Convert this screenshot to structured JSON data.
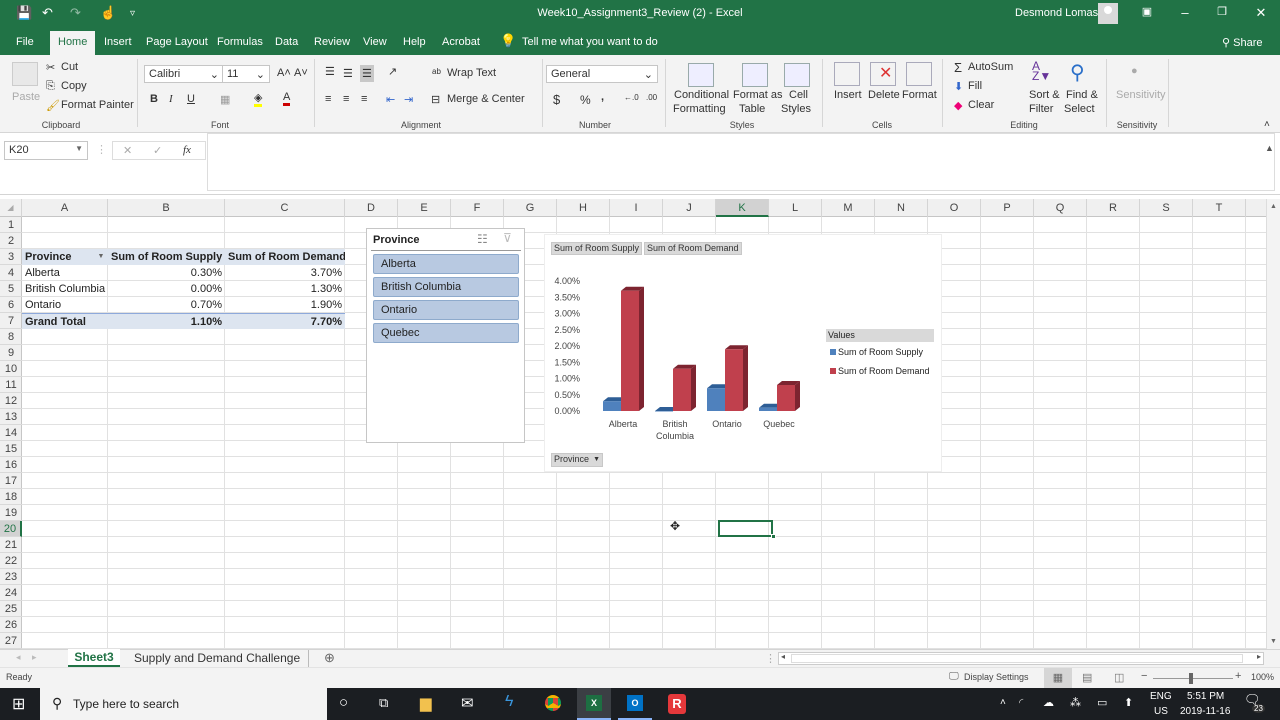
{
  "titlebar": {
    "title": "Week10_Assignment3_Review (2)  -  Excel",
    "user": "Desmond Lomas",
    "qat": {
      "save": "💾",
      "undo": "↶",
      "redo": "↷",
      "touch": "☝",
      "customize": "▿"
    }
  },
  "tabs": [
    "File",
    "Home",
    "Insert",
    "Page Layout",
    "Formulas",
    "Data",
    "Review",
    "View",
    "Help",
    "Acrobat"
  ],
  "tell_me": "Tell me what you want to do",
  "share": "Share",
  "ribbon": {
    "clipboard": {
      "paste": "Paste",
      "cut": "Cut",
      "copy": "Copy",
      "format_painter": "Format Painter",
      "label": "Clipboard"
    },
    "font": {
      "name": "Calibri",
      "size": "11",
      "label": "Font",
      "bold": "B",
      "italic": "I",
      "underline": "U"
    },
    "alignment": {
      "wrap": "Wrap Text",
      "merge": "Merge & Center",
      "label": "Alignment"
    },
    "number": {
      "format": "General",
      "label": "Number",
      "currency": "$",
      "percent": "%",
      "comma": ","
    },
    "styles": {
      "conditional": "Conditional",
      "conditional2": "Formatting",
      "format_table": "Format as",
      "format_table2": "Table",
      "cell_styles": "Cell",
      "cell_styles2": "Styles",
      "label": "Styles"
    },
    "cells": {
      "insert": "Insert",
      "delete": "Delete",
      "format": "Format",
      "label": "Cells"
    },
    "editing": {
      "autosum": "AutoSum",
      "fill": "Fill",
      "clear": "Clear",
      "sort": "Sort &",
      "sort2": "Filter",
      "find": "Find &",
      "find2": "Select",
      "label": "Editing"
    },
    "sensitivity": {
      "button": "Sensitivity",
      "label": "Sensitivity"
    }
  },
  "formula_bar": {
    "name_box": "K20",
    "cancel": "✕",
    "enter": "✓",
    "fx": "fx",
    "value": ""
  },
  "columns": [
    "A",
    "B",
    "C",
    "D",
    "E",
    "F",
    "G",
    "H",
    "I",
    "J",
    "K",
    "L",
    "M",
    "N",
    "O",
    "P",
    "Q",
    "R",
    "S",
    "T"
  ],
  "selected_column": "K",
  "rows": [
    "1",
    "2",
    "3",
    "4",
    "5",
    "6",
    "7",
    "8",
    "9",
    "10",
    "11",
    "12",
    "13",
    "14",
    "15",
    "16",
    "17",
    "18",
    "19",
    "20",
    "21",
    "22",
    "23",
    "24",
    "25",
    "26",
    "27"
  ],
  "selected_row": "20",
  "pivot": {
    "headers": [
      "Province",
      "Sum of  Room Supply",
      "Sum of Room Demand"
    ],
    "rows": [
      [
        "Alberta",
        "0.30%",
        "3.70%"
      ],
      [
        "British Columbia",
        "0.00%",
        "1.30%"
      ],
      [
        "Ontario",
        "0.70%",
        "1.90%"
      ],
      [
        "Quebec",
        "0.10%",
        "0.80%"
      ]
    ],
    "total": [
      "Grand Total",
      "1.10%",
      "7.70%"
    ]
  },
  "slicer": {
    "title": "Province",
    "items": [
      "Alberta",
      "British Columbia",
      "Ontario",
      "Quebec"
    ]
  },
  "chart_data": {
    "type": "bar",
    "title": "",
    "categories": [
      "Alberta",
      "British Columbia",
      "Ontario",
      "Quebec"
    ],
    "series": [
      {
        "name": "Sum of  Room Supply",
        "values": [
          0.3,
          0.0,
          0.7,
          0.1
        ],
        "color": "#4f81bd"
      },
      {
        "name": "Sum of Room Demand",
        "values": [
          3.7,
          1.3,
          1.9,
          0.8
        ],
        "color": "#c0404d"
      }
    ],
    "yticks": [
      "0.00%",
      "0.50%",
      "1.00%",
      "1.50%",
      "2.00%",
      "2.50%",
      "3.00%",
      "3.50%",
      "4.00%"
    ],
    "ylim": [
      0,
      4.0
    ],
    "xlabel": "",
    "ylabel": "",
    "legend_title": "Values",
    "legend_position": "right",
    "field_buttons": [
      "Sum of  Room Supply",
      "Sum of Room Demand"
    ],
    "axis_field_button": "Province",
    "style": "3d-clustered-column"
  },
  "sheets": [
    "Sheet3",
    "Supply and Demand Challenge"
  ],
  "active_sheet": "Sheet3",
  "status": {
    "ready": "Ready",
    "display_settings": "Display Settings",
    "zoom": "100%"
  },
  "taskbar": {
    "search_placeholder": "Type here to search",
    "lang1": "ENG",
    "lang2": "US",
    "time": "5:51 PM",
    "date": "2019-11-16",
    "notifications": "23"
  }
}
